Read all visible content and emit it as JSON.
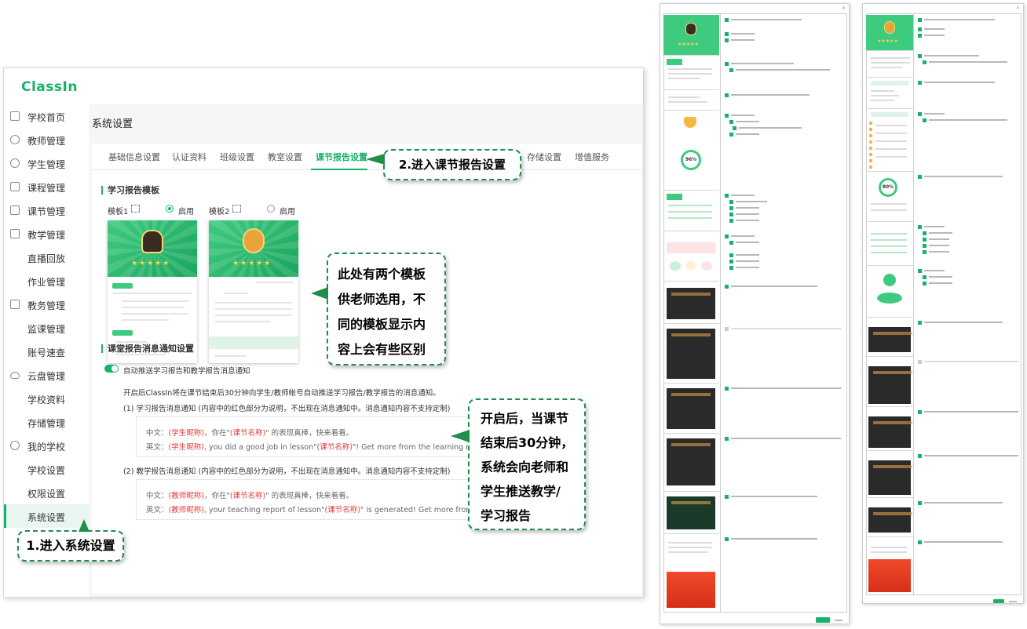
{
  "app": {
    "logo": "ClassIn",
    "page_title": "系统设置"
  },
  "sidebar": {
    "items": [
      {
        "label": "学校首页",
        "icon": "home-icon"
      },
      {
        "label": "教师管理",
        "icon": "teacher-icon"
      },
      {
        "label": "学生管理",
        "icon": "student-icon"
      },
      {
        "label": "课程管理",
        "icon": "course-icon"
      },
      {
        "label": "课节管理",
        "icon": "lesson-icon"
      },
      {
        "label": "教学管理",
        "icon": "teaching-icon"
      },
      {
        "label": "直播回放",
        "icon": ""
      },
      {
        "label": "作业管理",
        "icon": ""
      },
      {
        "label": "教务管理",
        "icon": "academic-icon"
      },
      {
        "label": "监课管理",
        "icon": ""
      },
      {
        "label": "账号速查",
        "icon": ""
      },
      {
        "label": "云盘管理",
        "icon": "cloud-icon"
      },
      {
        "label": "学校资料",
        "icon": ""
      },
      {
        "label": "存储管理",
        "icon": ""
      },
      {
        "label": "我的学校",
        "icon": "school-icon"
      },
      {
        "label": "学校设置",
        "icon": ""
      },
      {
        "label": "权限设置",
        "icon": ""
      },
      {
        "label": "系统设置",
        "icon": "",
        "active": true
      }
    ]
  },
  "tabs": [
    "基础信息设置",
    "认证资料",
    "班级设置",
    "教室设置",
    "课节报告设置",
    "存储设置",
    "增值服务"
  ],
  "active_tab": "课节报告设置",
  "report_template": {
    "section_title": "学习报告模板",
    "templates": [
      {
        "name": "模板1",
        "radio_label": "启用",
        "selected": true
      },
      {
        "name": "模板2",
        "radio_label": "启用",
        "selected": false
      }
    ]
  },
  "notify": {
    "section_title": "课堂报告消息通知设置",
    "toggle_label": "自动推送学习报告和教学报告消息通知",
    "toggle_on": true,
    "description": "开启后ClassIn将在课节结束后30分钟向学生/教师帐号自动推送学习报告/教学报告的消息通知。",
    "study_title": "(1) 学习报告消息通知 (内容中的红色部分为说明，不出现在消息通知中。消息通知内容不支持定制)",
    "study_cn_prefix": "中文：",
    "study_cn_red1": "(学生昵称)",
    "study_cn_mid": "，你在\"",
    "study_cn_red2": "(课节名称)",
    "study_cn_end": "\" 的表现真棒，快来看看。",
    "study_en_prefix": "英文：",
    "study_en_red1": "(学生昵称)",
    "study_en_mid": ", you did a good job in lesson\"",
    "study_en_red2": "(课节名称)",
    "study_en_end": "\"! Get more from the learning report.",
    "teach_title": "(2) 教学报告消息通知 (内容中的红色部分为说明，不出现在消息通知中。消息通知内容不支持定制)",
    "teach_cn_prefix": "中文：",
    "teach_cn_red1": "(教师昵称)",
    "teach_cn_mid": "，你在\"",
    "teach_cn_red2": "(课节名称)",
    "teach_cn_end": "\" 的表现真棒，快来看看。",
    "teach_en_prefix": "英文：",
    "teach_en_red1": "(教师昵称)",
    "teach_en_mid": ", your teaching report of lesson\"",
    "teach_en_red2": "(课节名称)",
    "teach_en_end": "\" is generated! Get more from it."
  },
  "callouts": {
    "step1": "1.进入系统设置",
    "step2": "2.进入课节报告设置",
    "templates": [
      "此处有两个模板",
      "供老师选用，不",
      "同的模板显示内",
      "容上会有些区别"
    ],
    "push": [
      "开启后，当课节",
      "结束后30分钟，",
      "系统会向老师和",
      "学生推送教学/",
      "学习报告"
    ]
  },
  "colors": {
    "brand": "#17b26a",
    "callout_border": "#1e8e4a",
    "red_text": "#e53935"
  }
}
